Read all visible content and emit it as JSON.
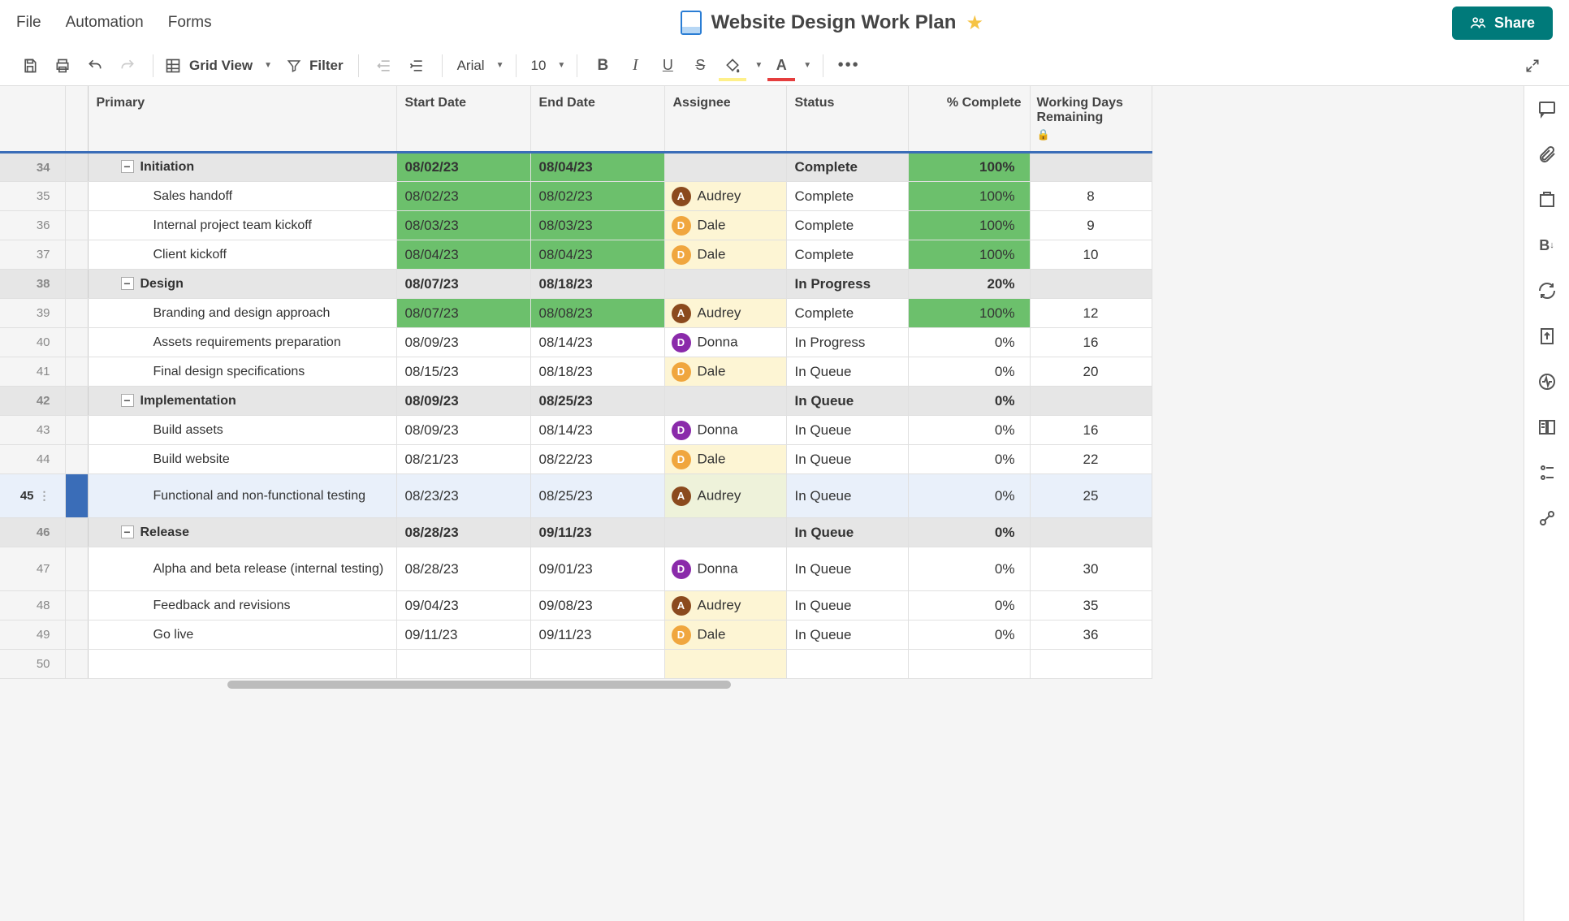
{
  "menubar": {
    "file": "File",
    "automation": "Automation",
    "forms": "Forms"
  },
  "doc": {
    "title": "Website Design Work Plan"
  },
  "share": {
    "label": "Share"
  },
  "toolbar": {
    "view": "Grid View",
    "filter": "Filter",
    "font": "Arial",
    "size": "10"
  },
  "columns": {
    "primary": "Primary",
    "start": "Start Date",
    "end": "End Date",
    "assignee": "Assignee",
    "status": "Status",
    "pct": "% Complete",
    "days": "Working Days Remaining"
  },
  "rows": [
    {
      "n": "34",
      "group": true,
      "label": "Initiation",
      "start": "08/02/23",
      "end": "08/04/23",
      "status": "Complete",
      "pct": "100%",
      "startBg": "green",
      "endBg": "green",
      "pctBg": "green"
    },
    {
      "n": "35",
      "label": "Sales handoff",
      "start": "08/02/23",
      "end": "08/02/23",
      "assignee": "Audrey",
      "ainit": "A",
      "aclass": "av-audrey",
      "status": "Complete",
      "pct": "100%",
      "days": "8",
      "startBg": "green",
      "endBg": "green",
      "assigneeBg": "yellow",
      "pctBg": "green"
    },
    {
      "n": "36",
      "label": "Internal project team kickoff",
      "start": "08/03/23",
      "end": "08/03/23",
      "assignee": "Dale",
      "ainit": "D",
      "aclass": "av-dale",
      "status": "Complete",
      "pct": "100%",
      "days": "9",
      "startBg": "green",
      "endBg": "green",
      "assigneeBg": "yellow",
      "pctBg": "green"
    },
    {
      "n": "37",
      "label": "Client kickoff",
      "start": "08/04/23",
      "end": "08/04/23",
      "assignee": "Dale",
      "ainit": "D",
      "aclass": "av-dale",
      "status": "Complete",
      "pct": "100%",
      "days": "10",
      "startBg": "green",
      "endBg": "green",
      "assigneeBg": "yellow",
      "pctBg": "green"
    },
    {
      "n": "38",
      "group": true,
      "label": "Design",
      "start": "08/07/23",
      "end": "08/18/23",
      "status": "In Progress",
      "pct": "20%"
    },
    {
      "n": "39",
      "label": "Branding and design approach",
      "start": "08/07/23",
      "end": "08/08/23",
      "assignee": "Audrey",
      "ainit": "A",
      "aclass": "av-audrey",
      "status": "Complete",
      "pct": "100%",
      "days": "12",
      "startBg": "green",
      "endBg": "green",
      "assigneeBg": "yellow",
      "pctBg": "green"
    },
    {
      "n": "40",
      "label": "Assets requirements preparation",
      "start": "08/09/23",
      "end": "08/14/23",
      "assignee": "Donna",
      "ainit": "D",
      "aclass": "av-donna",
      "status": "In Progress",
      "pct": "0%",
      "days": "16"
    },
    {
      "n": "41",
      "label": "Final design specifications",
      "start": "08/15/23",
      "end": "08/18/23",
      "assignee": "Dale",
      "ainit": "D",
      "aclass": "av-dale",
      "status": "In Queue",
      "pct": "0%",
      "days": "20",
      "assigneeBg": "yellow"
    },
    {
      "n": "42",
      "group": true,
      "label": "Implementation",
      "start": "08/09/23",
      "end": "08/25/23",
      "status": "In Queue",
      "pct": "0%"
    },
    {
      "n": "43",
      "label": "Build assets",
      "start": "08/09/23",
      "end": "08/14/23",
      "assignee": "Donna",
      "ainit": "D",
      "aclass": "av-donna",
      "status": "In Queue",
      "pct": "0%",
      "days": "16"
    },
    {
      "n": "44",
      "label": "Build website",
      "start": "08/21/23",
      "end": "08/22/23",
      "assignee": "Dale",
      "ainit": "D",
      "aclass": "av-dale",
      "status": "In Queue",
      "pct": "0%",
      "days": "22",
      "assigneeBg": "yellow"
    },
    {
      "n": "45",
      "label": "Functional and non-functional testing",
      "start": "08/23/23",
      "end": "08/25/23",
      "assignee": "Audrey",
      "ainit": "A",
      "aclass": "av-audrey",
      "status": "In Queue",
      "pct": "0%",
      "days": "25",
      "assigneeBg": "yellow",
      "selected": true
    },
    {
      "n": "46",
      "group": true,
      "label": "Release",
      "start": "08/28/23",
      "end": "09/11/23",
      "status": "In Queue",
      "pct": "0%"
    },
    {
      "n": "47",
      "label": "Alpha and beta release (internal testing)",
      "start": "08/28/23",
      "end": "09/01/23",
      "assignee": "Donna",
      "ainit": "D",
      "aclass": "av-donna",
      "status": "In Queue",
      "pct": "0%",
      "days": "30"
    },
    {
      "n": "48",
      "label": "Feedback and revisions",
      "start": "09/04/23",
      "end": "09/08/23",
      "assignee": "Audrey",
      "ainit": "A",
      "aclass": "av-audrey",
      "status": "In Queue",
      "pct": "0%",
      "days": "35",
      "assigneeBg": "yellow"
    },
    {
      "n": "49",
      "label": "Go live",
      "start": "09/11/23",
      "end": "09/11/23",
      "assignee": "Dale",
      "ainit": "D",
      "aclass": "av-dale",
      "status": "In Queue",
      "pct": "0%",
      "days": "36",
      "assigneeBg": "yellow"
    },
    {
      "n": "50",
      "empty": true
    }
  ]
}
